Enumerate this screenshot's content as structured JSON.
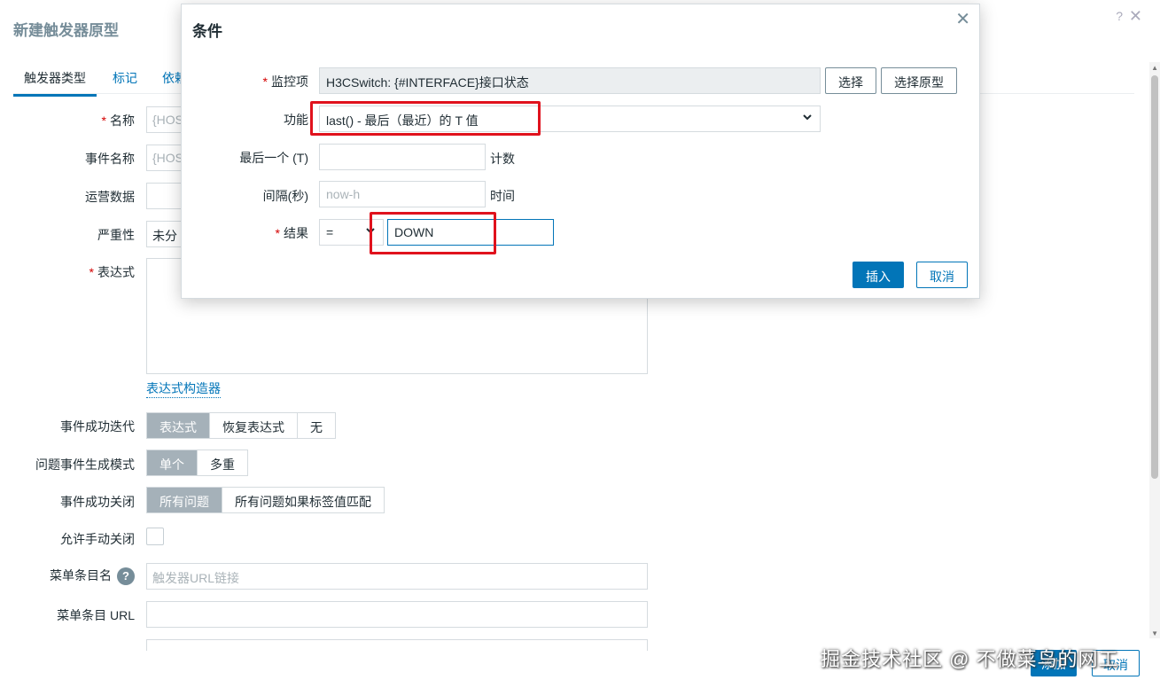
{
  "background": {
    "title": "新建触发器原型",
    "help": "?",
    "close": "✕",
    "tabs": [
      "触发器类型",
      "标记",
      "依赖"
    ],
    "fields": {
      "name_label": "名称",
      "name_value": "{HOS",
      "event_name_label": "事件名称",
      "event_name_value": "{HOS",
      "opdata_label": "运营数据",
      "severity_label": "严重性",
      "severity_value": "未分",
      "expression_label": "表达式",
      "expression_builder": "表达式构造器",
      "ok_event_gen_label": "事件成功迭代",
      "ok_event_gen_options": [
        "表达式",
        "恢复表达式",
        "无"
      ],
      "problem_mode_label": "问题事件生成模式",
      "problem_mode_options": [
        "单个",
        "多重"
      ],
      "ok_close_label": "事件成功关闭",
      "ok_close_options": [
        "所有问题",
        "所有问题如果标签值匹配"
      ],
      "manual_close_label": "允许手动关闭",
      "menu_name_label": "菜单条目名",
      "menu_name_help": "?",
      "menu_name_placeholder": "触发器URL链接",
      "menu_url_label": "菜单条目 URL"
    },
    "buttons": {
      "add": "添加",
      "cancel": "取消"
    }
  },
  "dialog": {
    "title": "条件",
    "close": "✕",
    "item_label": "监控项",
    "item_value": "H3CSwitch: {#INTERFACE}接口状态",
    "select_button": "选择",
    "select_prototype_button": "选择原型",
    "function_label": "功能",
    "function_value": "last() - 最后（最近）的 T 值",
    "last_label": "最后一个 (T)",
    "last_value": "",
    "last_suffix": "计数",
    "interval_label": "间隔(秒)",
    "interval_placeholder": "now-h",
    "interval_suffix": "时间",
    "result_label": "结果",
    "result_operator": "=",
    "result_value": "DOWN",
    "insert_button": "插入",
    "cancel_button": "取消"
  },
  "watermark": "掘金技术社区 @ 不做菜鸟的网工",
  "colors": {
    "accent": "#0275b8",
    "highlight": "#e0121d",
    "segment_active": "#a5b1b9"
  }
}
